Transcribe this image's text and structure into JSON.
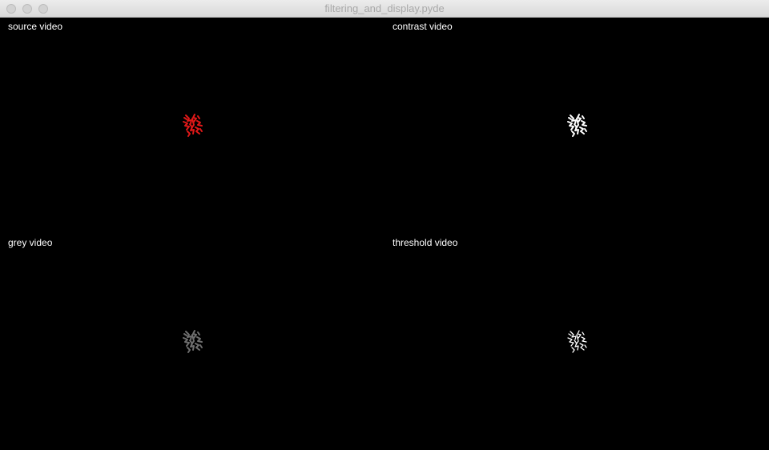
{
  "window": {
    "title": "filtering_and_display.pyde"
  },
  "panels": [
    {
      "label": "source video",
      "blob_color": "#e01818"
    },
    {
      "label": "contrast video",
      "blob_color": "#ffffff"
    },
    {
      "label": "grey video",
      "blob_color": "#6e6e6e"
    },
    {
      "label": "threshold video",
      "blob_color": "#ffffff"
    }
  ]
}
